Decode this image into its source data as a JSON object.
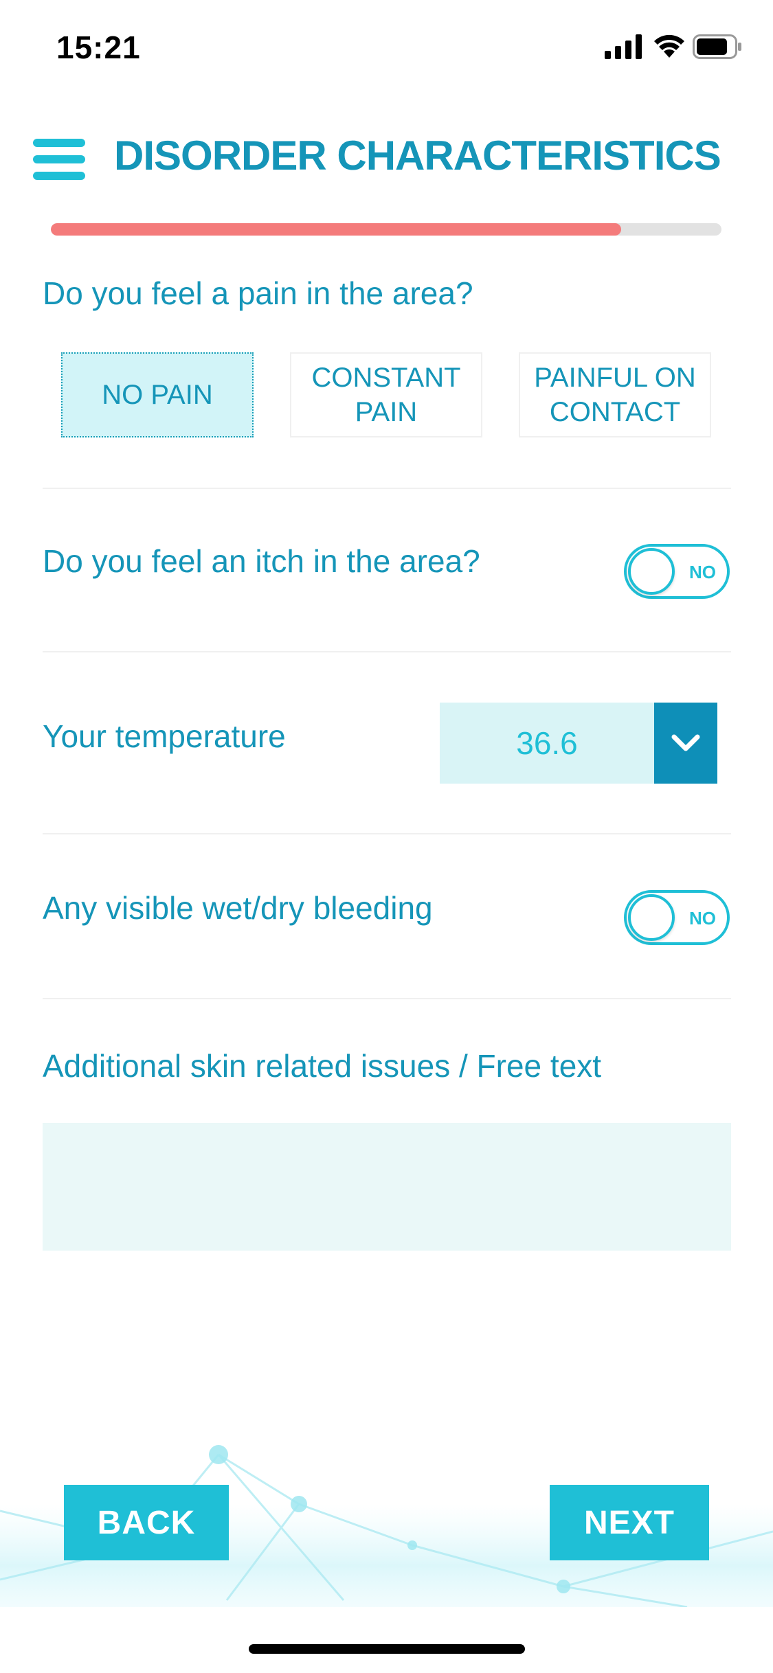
{
  "status_bar": {
    "time": "15:21"
  },
  "header": {
    "title": "DISORDER CHARACTERISTICS"
  },
  "progress": {
    "fraction": 0.85
  },
  "pain": {
    "question": "Do you feel a pain in the area?",
    "options": [
      "NO PAIN",
      "CONSTANT PAIN",
      "PAINFUL ON CONTACT"
    ],
    "selected": "NO PAIN"
  },
  "itch": {
    "question": "Do you feel an itch in the area?",
    "toggle_label": "NO"
  },
  "temperature": {
    "label": "Your temperature",
    "value": "36.6"
  },
  "bleeding": {
    "question": "Any visible wet/dry bleeding",
    "toggle_label": "NO"
  },
  "notes": {
    "label": "Additional skin related issues / Free text",
    "value": ""
  },
  "navigation": {
    "back_label": "BACK",
    "next_label": "NEXT"
  },
  "colors": {
    "accent": "#1fbfd6",
    "title": "#1595b8",
    "progress": "#f47b7b",
    "select_arrow_bg": "#0e8fb8"
  },
  "icons": [
    "menu-icon",
    "signal-icon",
    "wifi-icon",
    "battery-icon",
    "chevron-down-icon"
  ]
}
